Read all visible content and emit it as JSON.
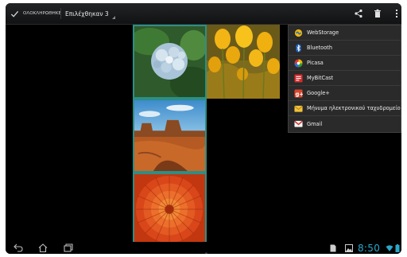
{
  "action_bar": {
    "done_label": "ΟΛΟΚΛΗΡΩΘΗΚΕ",
    "selection_label": "Επιλέχθηκαν 3"
  },
  "share_menu": {
    "items": [
      {
        "label": "WebStorage",
        "icon": "webstorage-icon"
      },
      {
        "label": "Bluetooth",
        "icon": "bluetooth-icon"
      },
      {
        "label": "Picasa",
        "icon": "picasa-icon"
      },
      {
        "label": "MyBitCast",
        "icon": "mybitcast-icon"
      },
      {
        "label": "Google+",
        "icon": "google-plus-icon"
      },
      {
        "label": "Μήνυμα ηλεκτρονικού ταχυδρομείου",
        "icon": "email-icon"
      },
      {
        "label": "Gmail",
        "icon": "gmail-icon"
      }
    ]
  },
  "gallery": {
    "photos": [
      {
        "subject": "hydrangea",
        "selected": true
      },
      {
        "subject": "tulips",
        "selected": false
      },
      {
        "subject": "desert",
        "selected": true
      },
      {
        "subject": "chrysanthemum",
        "selected": true
      }
    ]
  },
  "status_bar": {
    "time": "8:50"
  },
  "colors": {
    "accent": "#2c8f86",
    "clock": "#2aa7c9"
  }
}
